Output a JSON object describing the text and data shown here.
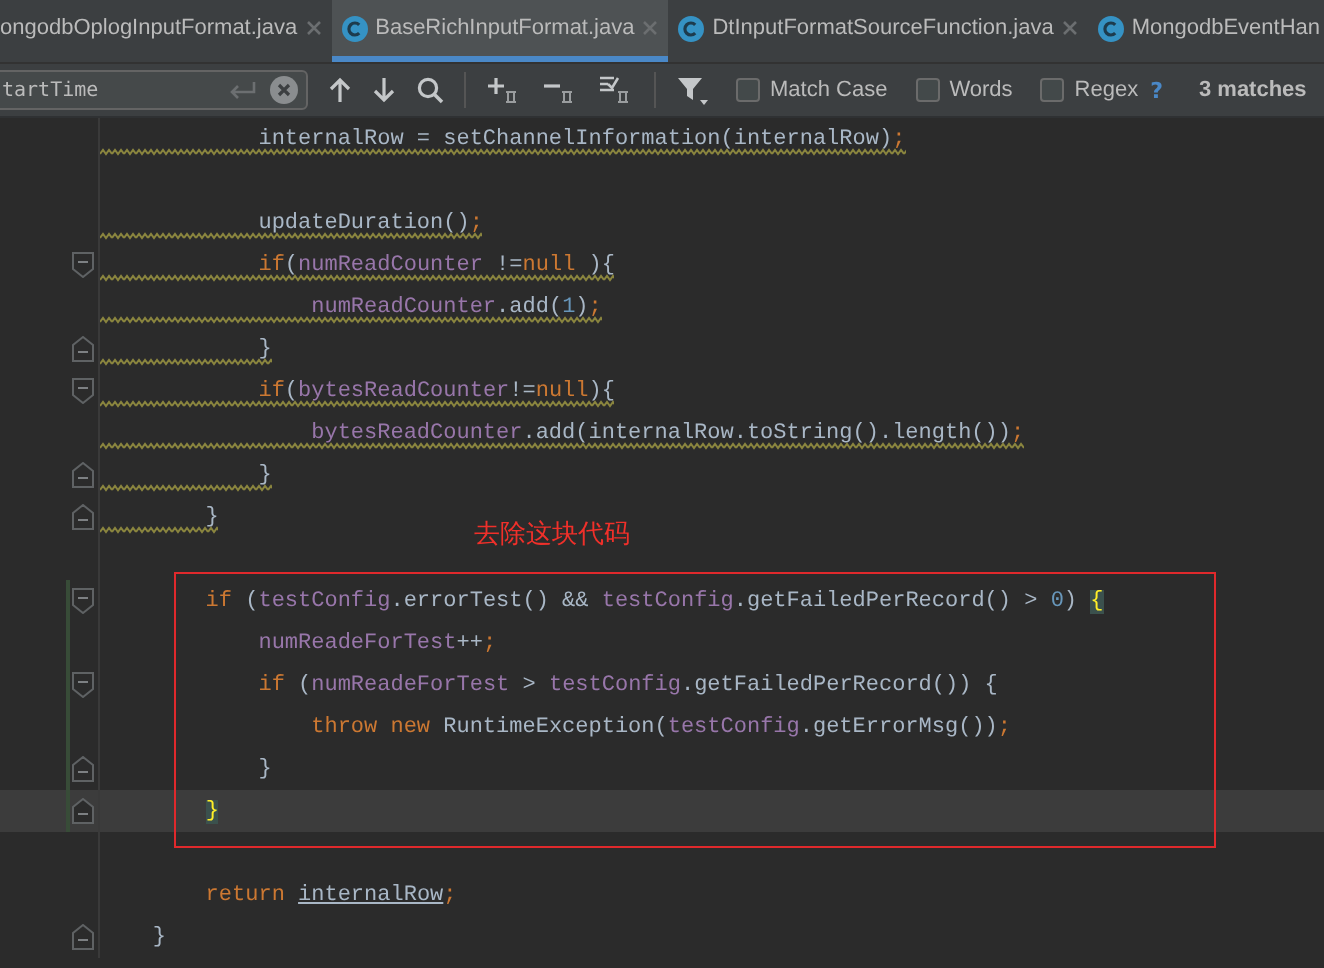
{
  "tabs": [
    {
      "label": "ongodbOplogInputFormat.java",
      "selected": false
    },
    {
      "label": "BaseRichInputFormat.java",
      "selected": true
    },
    {
      "label": "DtInputFormatSourceFunction.java",
      "selected": false
    },
    {
      "label": "MongodbEventHan",
      "selected": false
    }
  ],
  "find_bar": {
    "value": "tartTime",
    "options": [
      {
        "label": "Match Case",
        "checked": false
      },
      {
        "label": "Words",
        "checked": false
      },
      {
        "label": "Regex",
        "checked": false
      }
    ],
    "help": "?",
    "matches": "3 matches"
  },
  "annotation": "去除这块代码",
  "code_lines": [
    {
      "warning": true,
      "fold_start": false,
      "fold_end": false,
      "changed": false,
      "current": false,
      "tokens": [
        {
          "t": "            internalRow = setChannelInformation(internalRow)",
          "kind": "plain"
        },
        {
          "t": ";",
          "kind": "punct"
        }
      ]
    },
    {
      "warning": false,
      "fold_start": false,
      "fold_end": false,
      "changed": false,
      "current": false
    },
    {
      "warning": true,
      "fold_start": false,
      "fold_end": false,
      "changed": false,
      "current": false,
      "tokens": [
        {
          "t": "            updateDuration()",
          "kind": "plain"
        },
        {
          "t": ";",
          "kind": "punct"
        }
      ]
    },
    {
      "warning": true,
      "fold_start": true,
      "fold_end": false,
      "changed": false,
      "current": false,
      "tokens": [
        {
          "t": "            if",
          "kind": "keyword"
        },
        {
          "t": "(",
          "kind": "plain"
        },
        {
          "t": "numReadCounter",
          "kind": "field"
        },
        {
          "t": " !=",
          "kind": "plain"
        },
        {
          "t": "null",
          "kind": "keyword"
        },
        {
          "t": " ){",
          "kind": "plain"
        }
      ]
    },
    {
      "warning": true,
      "fold_start": false,
      "fold_end": false,
      "changed": false,
      "current": false,
      "tokens": [
        {
          "t": "                numReadCounter",
          "kind": "field"
        },
        {
          "t": ".add(",
          "kind": "plain"
        },
        {
          "t": "1",
          "kind": "number"
        },
        {
          "t": ")",
          "kind": "plain"
        },
        {
          "t": ";",
          "kind": "punct"
        }
      ]
    },
    {
      "warning": true,
      "fold_start": false,
      "fold_end": true,
      "changed": false,
      "current": false,
      "tokens": [
        {
          "t": "            }",
          "kind": "plain"
        }
      ]
    },
    {
      "warning": true,
      "fold_start": true,
      "fold_end": false,
      "changed": false,
      "current": false,
      "tokens": [
        {
          "t": "            if",
          "kind": "keyword"
        },
        {
          "t": "(",
          "kind": "plain"
        },
        {
          "t": "bytesReadCounter",
          "kind": "field"
        },
        {
          "t": "!=",
          "kind": "plain"
        },
        {
          "t": "null",
          "kind": "keyword"
        },
        {
          "t": "){",
          "kind": "plain"
        }
      ]
    },
    {
      "warning": true,
      "fold_start": false,
      "fold_end": false,
      "changed": false,
      "current": false,
      "tokens": [
        {
          "t": "                bytesReadCounter",
          "kind": "field"
        },
        {
          "t": ".add(internalRow.toString().length())",
          "kind": "plain"
        },
        {
          "t": ";",
          "kind": "punct"
        }
      ]
    },
    {
      "warning": true,
      "fold_start": false,
      "fold_end": true,
      "changed": false,
      "current": false,
      "tokens": [
        {
          "t": "            }",
          "kind": "plain"
        }
      ]
    },
    {
      "warning": true,
      "fold_start": false,
      "fold_end": true,
      "changed": false,
      "current": false,
      "tokens": [
        {
          "t": "        }",
          "kind": "plain"
        }
      ]
    },
    {
      "warning": false,
      "fold_start": false,
      "fold_end": false,
      "changed": false,
      "current": false
    },
    {
      "warning": false,
      "fold_start": true,
      "fold_end": false,
      "changed": true,
      "current": false,
      "tokens": [
        {
          "t": "        if",
          "kind": "keyword"
        },
        {
          "t": " (",
          "kind": "plain"
        },
        {
          "t": "testConfig",
          "kind": "field"
        },
        {
          "t": ".errorTest() && ",
          "kind": "plain"
        },
        {
          "t": "testConfig",
          "kind": "field"
        },
        {
          "t": ".getFailedPerRecord() > ",
          "kind": "plain"
        },
        {
          "t": "0",
          "kind": "number"
        },
        {
          "t": ") ",
          "kind": "plain"
        },
        {
          "t": "{",
          "kind": "brace-match"
        }
      ]
    },
    {
      "warning": false,
      "fold_start": false,
      "fold_end": false,
      "changed": true,
      "current": false,
      "tokens": [
        {
          "t": "            numReadeForTest",
          "kind": "field"
        },
        {
          "t": "++",
          "kind": "plain"
        },
        {
          "t": ";",
          "kind": "punct"
        }
      ]
    },
    {
      "warning": false,
      "fold_start": true,
      "fold_end": false,
      "changed": true,
      "current": false,
      "tokens": [
        {
          "t": "            if",
          "kind": "keyword"
        },
        {
          "t": " (",
          "kind": "plain"
        },
        {
          "t": "numReadeForTest",
          "kind": "field"
        },
        {
          "t": " > ",
          "kind": "plain"
        },
        {
          "t": "testConfig",
          "kind": "field"
        },
        {
          "t": ".getFailedPerRecord()) {",
          "kind": "plain"
        }
      ]
    },
    {
      "warning": false,
      "fold_start": false,
      "fold_end": false,
      "changed": true,
      "current": false,
      "tokens": [
        {
          "t": "                throw new",
          "kind": "keyword"
        },
        {
          "t": " RuntimeException(",
          "kind": "plain"
        },
        {
          "t": "testConfig",
          "kind": "field"
        },
        {
          "t": ".getErrorMsg())",
          "kind": "plain"
        },
        {
          "t": ";",
          "kind": "punct"
        }
      ]
    },
    {
      "warning": false,
      "fold_start": false,
      "fold_end": true,
      "changed": true,
      "current": false,
      "tokens": [
        {
          "t": "            }",
          "kind": "plain"
        }
      ]
    },
    {
      "warning": false,
      "fold_start": false,
      "fold_end": true,
      "changed": true,
      "current": true,
      "tokens": [
        {
          "t": "        }",
          "kind": "brace-match"
        }
      ]
    },
    {
      "warning": false,
      "fold_start": false,
      "fold_end": false,
      "changed": false,
      "current": false
    },
    {
      "warning": false,
      "fold_start": false,
      "fold_end": false,
      "changed": false,
      "current": false,
      "tokens": [
        {
          "t": "        return ",
          "kind": "keyword"
        },
        {
          "t": "internalRow",
          "kind": "underlined"
        },
        {
          "t": ";",
          "kind": "punct"
        }
      ]
    },
    {
      "warning": false,
      "fold_start": false,
      "fold_end": true,
      "changed": false,
      "current": false,
      "tokens": [
        {
          "t": "    }",
          "kind": "plain"
        }
      ]
    }
  ]
}
